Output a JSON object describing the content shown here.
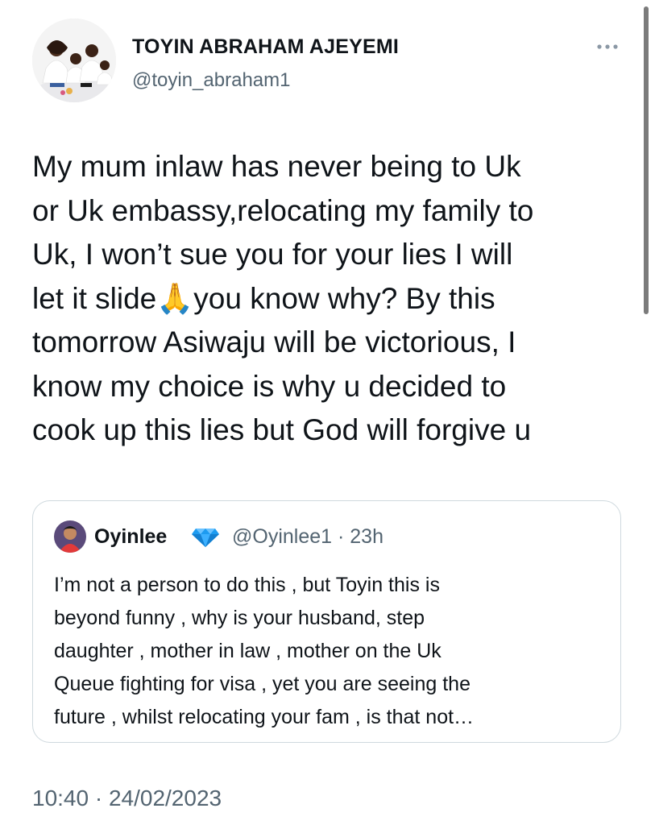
{
  "tweet": {
    "display_name": "TOYIN ABRAHAM AJEYEMI",
    "handle": "@toyin_abraham1",
    "more_icon": "more-horizontal-icon",
    "text": "My mum inlaw has never being to Uk\nor Uk embassy,relocating my family to\nUk, I won’t sue you for your lies I will\nlet it slide🙏you know why? By this\ntomorrow Asiwaju will be victorious, I\nknow my choice is why u decided to\ncook up this lies but God will forgive u",
    "timestamp": "10:40 · 24/02/2023"
  },
  "quoted_tweet": {
    "display_name": "Oyinlee",
    "badge_icon": "diamond-icon",
    "handle_time": "@Oyinlee1 · 23h",
    "text": "I’m not a person to do this , but Toyin this is\nbeyond funny , why is your husband, step\ndaughter , mother in law , mother  on the Uk\nQueue fighting for visa , yet you are seeing the\nfuture , whilst relocating your fam , is that not…"
  },
  "colors": {
    "text_primary": "#0f1419",
    "text_secondary": "#536471",
    "border": "#cfd9de",
    "badge": "#1d9bf0"
  }
}
